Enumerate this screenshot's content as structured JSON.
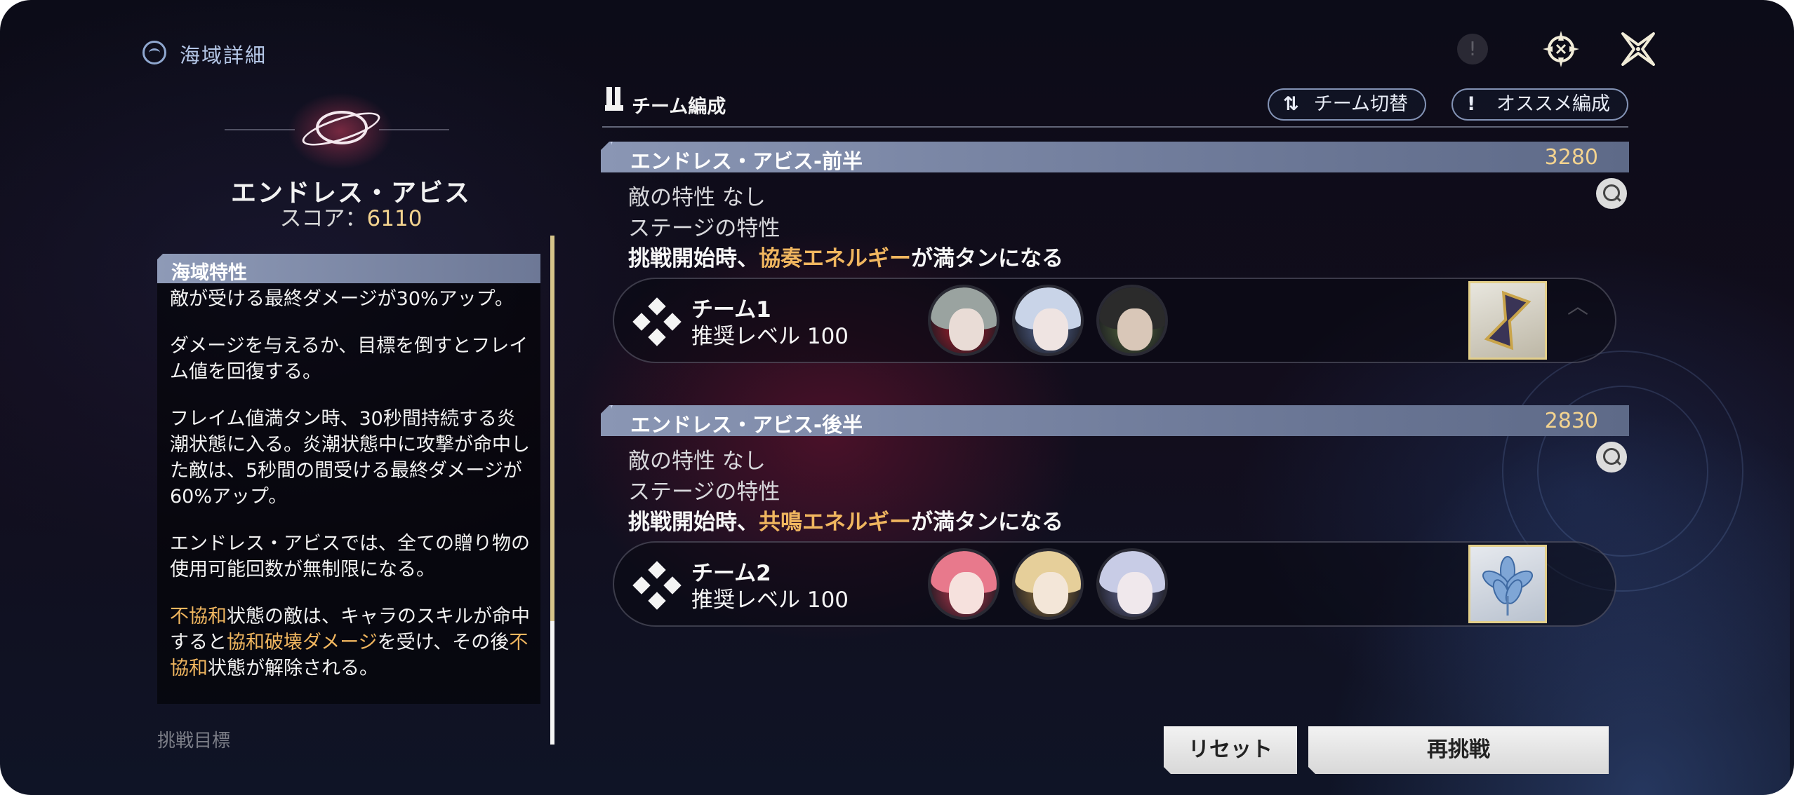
{
  "header": {
    "title": "海域詳細"
  },
  "abyss": {
    "name": "エンドレス・アビス",
    "score_label": "スコア：",
    "score_value": "6110"
  },
  "properties": {
    "heading": "海域特性",
    "p1": "敵が受ける最終ダメージが30%アップ。",
    "p2": "ダメージを与えるか、目標を倒すとフレイム値を回復する。",
    "p3": "フレイム値満タン時、30秒間持続する炎潮状態に入る。炎潮状態中に攻撃が命中した敵は、5秒間の間受ける最終ダメージが60%アップ。",
    "p4": "エンドレス・アビスでは、全ての贈り物の使用可能回数が無制限になる。",
    "p5": {
      "a": "不協和",
      "b": "状態の敵は、キャラのスキルが命中すると",
      "c": "協和破壊ダメージ",
      "d": "を受け、その後",
      "e": "不協和",
      "f": "状態が解除される。"
    },
    "faded_next": "挑戦目標"
  },
  "team_comp": {
    "label": "チーム編成",
    "switch_btn": "チーム切替",
    "switch_icon": "⇅",
    "recommend_btn": "オススメ編成",
    "recommend_icon": "!"
  },
  "halves": [
    {
      "name": "エンドレス・アビス-前半",
      "score": "3280",
      "enemy_trait": "敵の特性 なし",
      "stage_trait_label": "ステージの特性",
      "stage_trait": {
        "pre": "挑戦開始時、",
        "hl": "協奏エネルギー",
        "post": "が満タンになる"
      },
      "team": {
        "name": "チーム1",
        "level": "推奨レベル 100",
        "avatars": [
          {
            "hair": "#9aa3a0",
            "face": "#e9dcd6",
            "accent": "#b51c2c"
          },
          {
            "hair": "#c9d4e8",
            "face": "#efe4e2",
            "accent": "#5a6d9a"
          },
          {
            "hair": "#2b2b2b",
            "face": "#d9c7b8",
            "accent": "#556b3a"
          }
        ]
      }
    },
    {
      "name": "エンドレス・アビス-後半",
      "score": "2830",
      "enemy_trait": "敵の特性 なし",
      "stage_trait_label": "ステージの特性",
      "stage_trait": {
        "pre": "挑戦開始時、",
        "hl": "共鳴エネルギー",
        "post": "が満タンになる"
      },
      "team": {
        "name": "チーム2",
        "level": "推奨レベル 100",
        "avatars": [
          {
            "hair": "#e8798c",
            "face": "#f6e1dd",
            "accent": "#c2364e"
          },
          {
            "hair": "#e6cf9a",
            "face": "#f3e6d8",
            "accent": "#9a7a3e"
          },
          {
            "hair": "#c8cce6",
            "face": "#f0e8ec",
            "accent": "#6a6f9c"
          }
        ]
      }
    }
  ],
  "buttons": {
    "reset": "リセット",
    "retry": "再挑戦"
  },
  "colors": {
    "gold": "#f3d38f",
    "highlight": "#f0b65f"
  }
}
